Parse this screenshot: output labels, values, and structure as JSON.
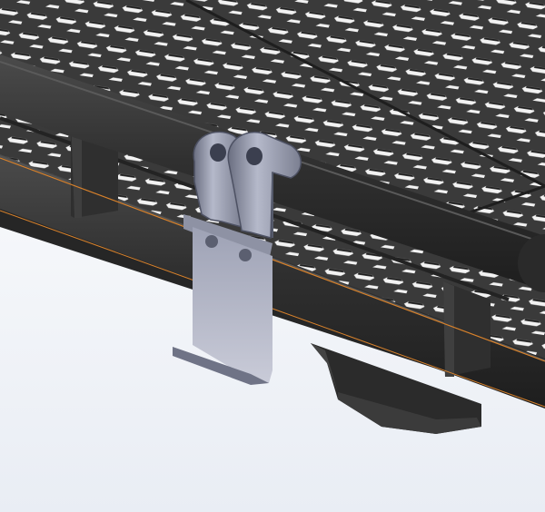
{
  "viewport": {
    "background_top": "#ffffff",
    "background_bottom": "#e9edf4"
  },
  "scene": {
    "panel_color": "#3a3a3a",
    "panel_dark": "#2a2a2a",
    "hole_color": "#f4f4f4",
    "hole_shadow": "#1c1c1c",
    "rail_color": "#2f2f2f",
    "rail_highlight": "#4a4a4a",
    "edge_line_color": "#d9822b",
    "clamp_color": "#8d91a3",
    "clamp_light": "#c2c6d6",
    "clamp_dark": "#5b5f70",
    "bracket_color": "#2c2c2c"
  },
  "icons": {
    "clamp": "rail-clamp-icon",
    "bracket": "support-bracket-icon"
  }
}
